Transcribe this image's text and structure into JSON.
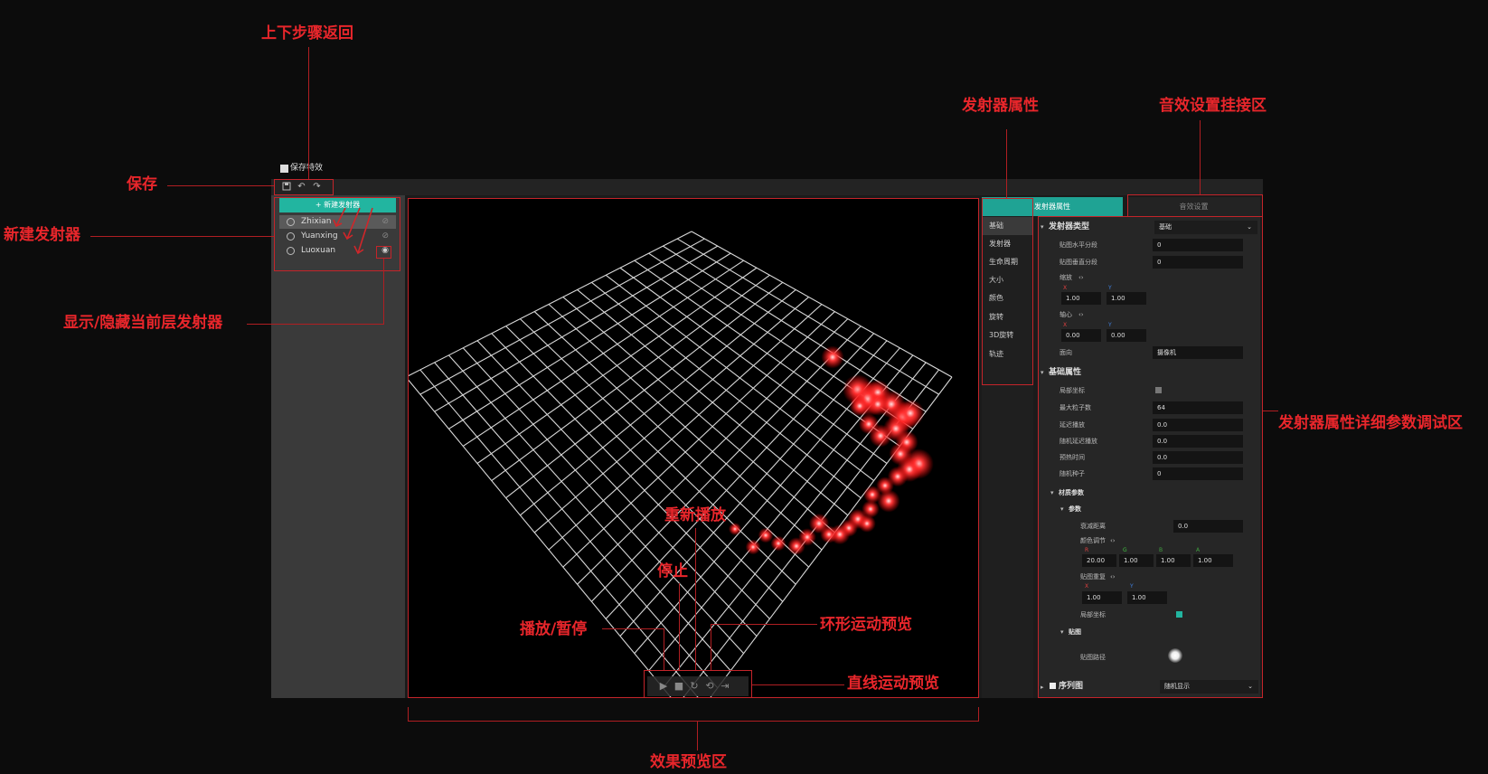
{
  "app": {
    "save_checkbox_label": "保存特效",
    "save_icon": "save-icon",
    "undo_icon": "undo-icon",
    "redo_icon": "redo-icon"
  },
  "emitters": {
    "new_button": "+ 新建发射器",
    "items": [
      {
        "name": "Zhixian"
      },
      {
        "name": "Yuanxing"
      },
      {
        "name": "Luoxuan"
      }
    ]
  },
  "tabs": {
    "attributes": "发射器属性",
    "sound": "音效设置"
  },
  "side_tabs": [
    "基础",
    "发射器",
    "生命周期",
    "大小",
    "颜色",
    "旋转",
    "3D旋转",
    "轨迹"
  ],
  "props": {
    "emitter_type_label": "发射器类型",
    "emitter_type_value": "基础",
    "tex_h_label": "贴图水平分段",
    "tex_h_value": "0",
    "tex_v_label": "贴图垂直分段",
    "tex_v_value": "0",
    "scale_label": "缩放",
    "scale_x": "1.00",
    "scale_y": "1.00",
    "pivot_label": "轴心",
    "pivot_x": "0.00",
    "pivot_y": "0.00",
    "facing_label": "面向",
    "facing_value": "摄像机",
    "base_section": "基础属性",
    "local_coord_label": "局部坐标",
    "max_particles_label": "最大粒子数",
    "max_particles_value": "64",
    "delay_label": "延迟播放",
    "delay_value": "0.0",
    "rand_delay_label": "随机延迟播放",
    "rand_delay_value": "0.0",
    "prewarm_label": "预热时间",
    "prewarm_value": "0.0",
    "seed_label": "随机种子",
    "seed_value": "0",
    "material_section": "材质参数",
    "params_section": "参数",
    "falloff_label": "衰减距离",
    "falloff_value": "0.0",
    "color_adjust_label": "颜色调节",
    "color_r": "20.00",
    "color_g": "1.00",
    "color_b": "1.00",
    "color_a": "1.00",
    "tex_repeat_label": "贴图重复",
    "repeat_x": "1.00",
    "repeat_y": "1.00",
    "local_coord2_label": "局部坐标",
    "texture_section": "贴图",
    "texture_path_label": "贴图路径",
    "sequence_label": "序列图",
    "sequence_value": "随机显示",
    "axis_x": "X",
    "axis_y": "Y",
    "axis_r": "R",
    "axis_g": "G",
    "axis_b": "B",
    "axis_a": "A"
  },
  "preview_controls": [
    "play-icon",
    "stop-icon",
    "restart-icon",
    "loop-move-icon",
    "line-move-icon"
  ],
  "annotations": {
    "undo_redo": "上下步骤返回",
    "save": "保存",
    "new_emitter": "新建发射器",
    "toggle_visibility": "显示/隐藏当前层发射器",
    "emitter_attributes": "发射器属性",
    "sound_settings": "音效设置挂接区",
    "detail_params": "发射器属性详细参数调试区",
    "restart": "重新播放",
    "stop": "停止",
    "play_pause": "播放/暂停",
    "loop_preview": "环形运动预览",
    "line_preview": "直线运动预览",
    "preview_area": "效果预览区"
  },
  "colors": {
    "accent": "#22b5a0",
    "annotation": "#e8262b",
    "particle": "#ff3030"
  }
}
